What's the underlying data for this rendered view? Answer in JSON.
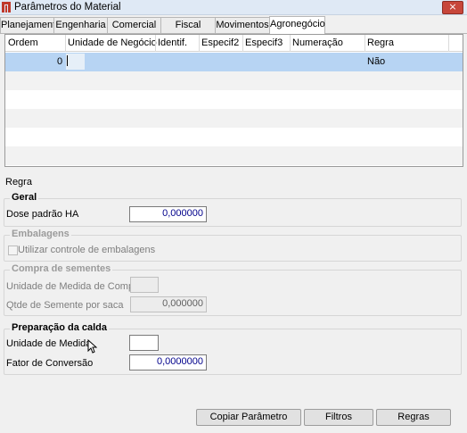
{
  "window": {
    "title": "Parâmetros do Material",
    "close_glyph": "×"
  },
  "tabs": [
    "Planejamento",
    "Engenharia",
    "Comercial",
    "Fiscal",
    "Movimentos",
    "Agronegócio"
  ],
  "grid": {
    "columns": [
      "Ordem",
      "Unidade de Negócio",
      "Identif.",
      "Especif2",
      "Especif3",
      "Numeração",
      "Regra"
    ],
    "rows": [
      {
        "ordem": "0",
        "regra": "Não"
      }
    ]
  },
  "regra_label": "Regra",
  "geral": {
    "title": "Geral",
    "dose_label": "Dose padrão HA",
    "dose_value": "0,000000"
  },
  "embalagens": {
    "title": "Embalagens",
    "checkbox_label": "Utilizar controle de embalagens"
  },
  "sementes": {
    "title": "Compra de sementes",
    "unidade_label": "Unidade de Medida de Compra",
    "unidade_value": "",
    "qtde_label": "Qtde de Semente por saca",
    "qtde_value": "0,000000"
  },
  "calda": {
    "title": "Preparação da calda",
    "unidade_label": "Unidade de Medida",
    "unidade_value": "",
    "fator_label": "Fator de Conversão",
    "fator_value": "0,0000000"
  },
  "buttons": {
    "copiar": "Copiar Parâmetro",
    "filtros": "Filtros",
    "regras": "Regras"
  },
  "colors": {
    "selected_row": "#b7d4f3",
    "value_text": "#00008b",
    "close_button": "#c7463a"
  }
}
